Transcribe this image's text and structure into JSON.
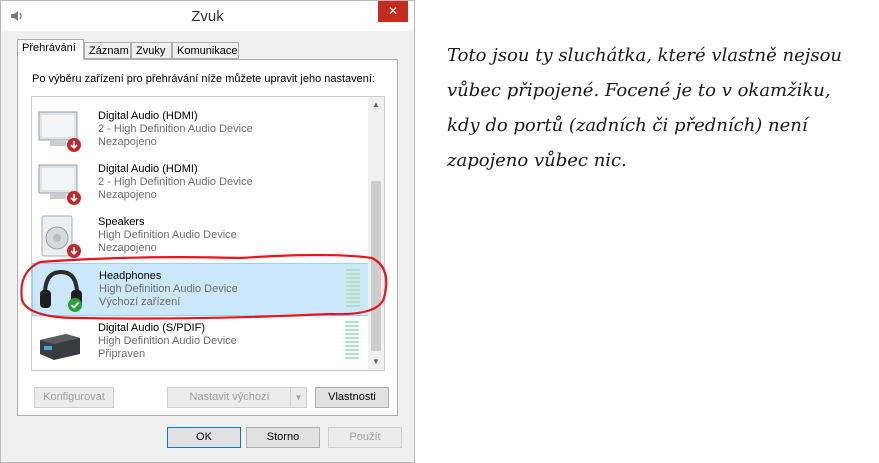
{
  "window": {
    "title": "Zvuk",
    "close_glyph": "✕"
  },
  "tabs": [
    {
      "label": "Přehrávání",
      "active": true
    },
    {
      "label": "Záznam",
      "active": false
    },
    {
      "label": "Zvuky",
      "active": false
    },
    {
      "label": "Komunikace",
      "active": false
    }
  ],
  "description": "Po výběru zařízení pro přehrávání níže můžete upravit jeho nastavení:",
  "devices": [
    {
      "name": "Digital Audio (HDMI)",
      "sub": "2 - High Definition Audio Device",
      "status": "Nezapojeno",
      "icon": "monitor-icon",
      "badge": "unplugged-icon"
    },
    {
      "name": "Digital Audio (HDMI)",
      "sub": "2 - High Definition Audio Device",
      "status": "Nezapojeno",
      "icon": "monitor-icon",
      "badge": "unplugged-icon"
    },
    {
      "name": "Speakers",
      "sub": "High Definition Audio Device",
      "status": "Nezapojeno",
      "icon": "speaker-icon",
      "badge": "unplugged-icon"
    },
    {
      "name": "Headphones",
      "sub": "High Definition Audio Device",
      "status": "Výchozí zařízení",
      "icon": "headphones-icon",
      "badge": "default-check-icon",
      "selected": true
    },
    {
      "name": "Digital Audio (S/PDIF)",
      "sub": "High Definition Audio Device",
      "status": "Připraven",
      "icon": "receiver-icon"
    }
  ],
  "buttons": {
    "configure": "Konfigurovat",
    "set_default": "Nastavit výchozí",
    "properties": "Vlastnosti",
    "ok": "OK",
    "cancel": "Storno",
    "apply": "Použít"
  },
  "annotation": {
    "lines": [
      "Toto jsou ty sluchátka, které vlastně nejsou",
      "vůbec připojené. Focené je to v okamžiku,",
      "kdy do portů (zadních či předních) není",
      "zapojeno vůbec nic."
    ],
    "circle_color": "#e8141e"
  },
  "colors": {
    "selection": "#cce8ff",
    "accent": "#0078d7",
    "close": "#c42b1c"
  }
}
